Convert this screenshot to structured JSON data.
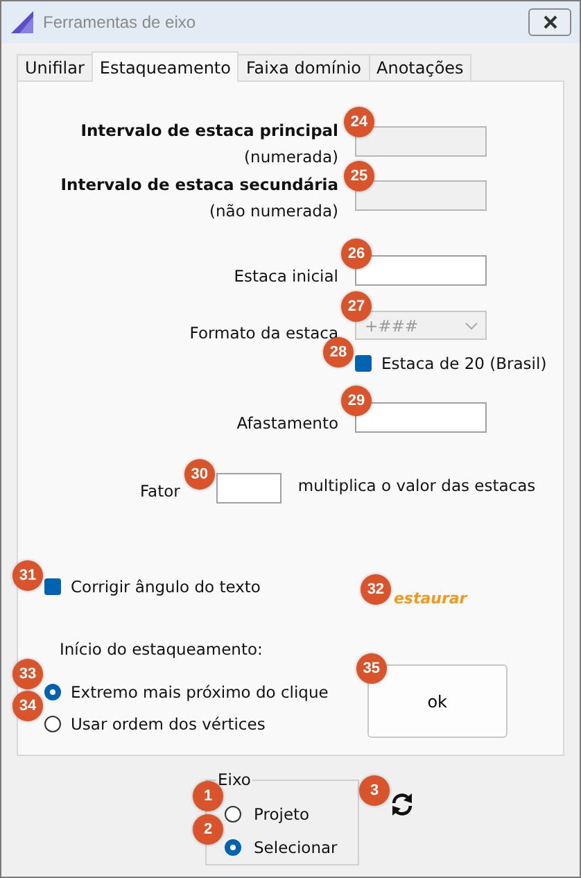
{
  "window": {
    "title": "Ferramentas de eixo"
  },
  "tabs": [
    {
      "label": "Unifilar",
      "selected": false
    },
    {
      "label": "Estaqueamento",
      "selected": true
    },
    {
      "label": "Faixa domínio",
      "selected": false
    },
    {
      "label": "Anotações",
      "selected": false
    }
  ],
  "intervals": [
    {
      "label": "Intervalo de estaca principal",
      "note": "(numerada)",
      "disabled": true,
      "badge": "24"
    },
    {
      "label": "Intervalo de estaca secundária",
      "note": "(não numerada)",
      "disabled": true,
      "badge": "25"
    }
  ],
  "initial_station": {
    "label": "Estaca inicial",
    "badge": "26"
  },
  "station_format": {
    "label": "Formato da estaca",
    "value": "+###",
    "disabled": true,
    "badge": "27"
  },
  "brazil_checkbox": {
    "label": "Estaca de 20 (Brasil)",
    "checked": true,
    "badge": "28"
  },
  "offset": {
    "label": "Afastamento",
    "badge": "29"
  },
  "factor": {
    "label": "Fator",
    "hint": "multiplica o valor das estacas",
    "badge": "30"
  },
  "fix_angle": {
    "label": "Corrigir ângulo do texto",
    "checked": true,
    "badge": "31"
  },
  "restore_link": {
    "label": "estaurar",
    "badge": "32"
  },
  "start_group": {
    "title": "Início do estaqueamento:",
    "options": [
      {
        "label": "Extremo mais próximo do clique",
        "selected": true,
        "badge": "33"
      },
      {
        "label": "Usar ordem dos vértices",
        "selected": false,
        "badge": "34"
      }
    ]
  },
  "ok_button": {
    "label": "ok",
    "badge": "35"
  },
  "fixed_group": {
    "title": "Eixo",
    "options": [
      {
        "label": "Projeto",
        "selected": false,
        "badge": "1"
      },
      {
        "label": "Selecionar",
        "selected": true,
        "badge": "2"
      }
    ]
  },
  "refresh": {
    "badge": "3"
  }
}
